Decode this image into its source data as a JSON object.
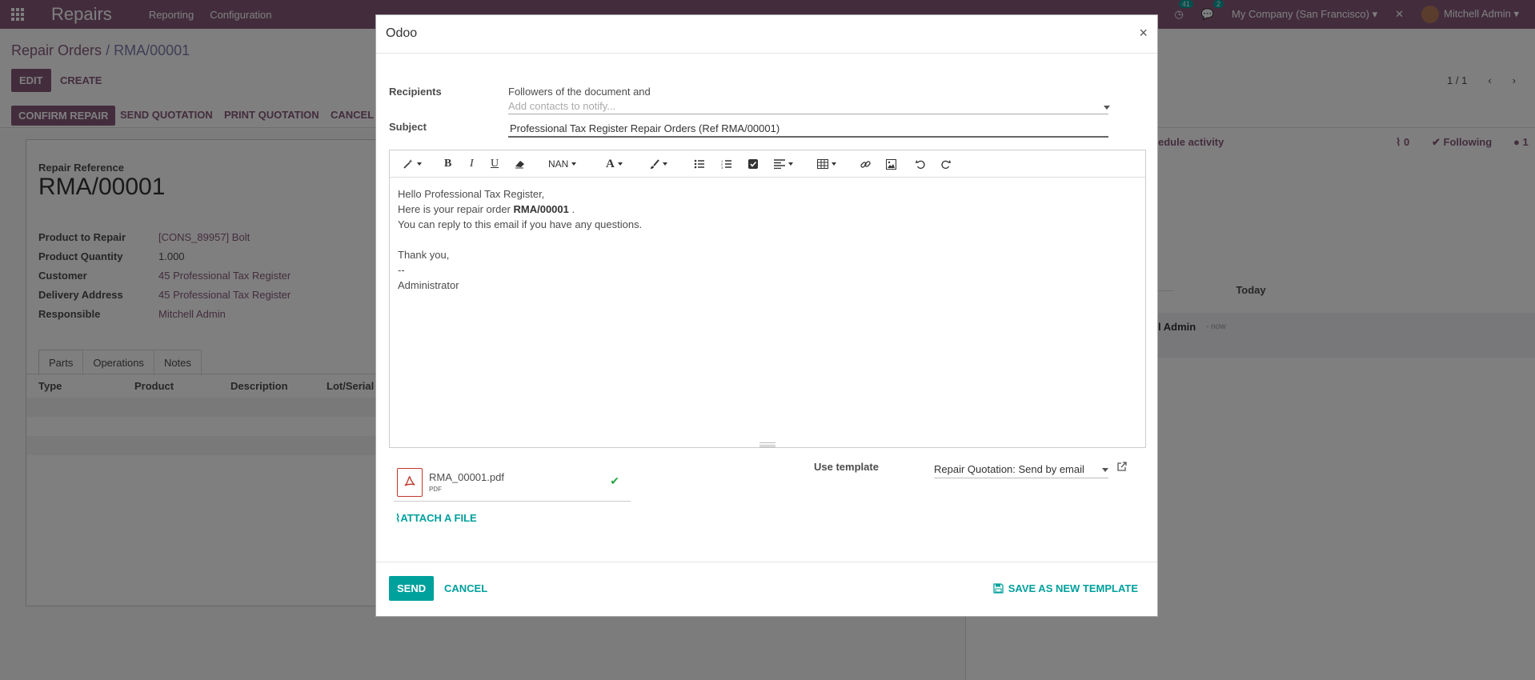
{
  "navbar": {
    "app_name": "Repairs",
    "menu": [
      "Reporting",
      "Configuration"
    ],
    "activity_count": "41",
    "message_count": "2",
    "company": "My Company (San Francisco)",
    "user": "Mitchell Admin"
  },
  "control_panel": {
    "breadcrumb_parent": "Repair Orders",
    "breadcrumb_sep": "/",
    "breadcrumb_current": "RMA/00001",
    "edit_label": "EDIT",
    "create_label": "CREATE",
    "pager": "1 / 1"
  },
  "statusbar": {
    "confirm_label": "CONFIRM REPAIR",
    "send_quotation_label": "SEND QUOTATION",
    "print_quotation_label": "PRINT QUOTATION",
    "cancel_label": "CANCEL"
  },
  "form": {
    "ref_label": "Repair Reference",
    "ref_value": "RMA/00001",
    "fields": [
      {
        "label": "Product to Repair",
        "value": "[CONS_89957] Bolt"
      },
      {
        "label": "Product Quantity",
        "value": "1.000"
      },
      {
        "label": "Customer",
        "value": "45 Professional Tax Register"
      },
      {
        "label": "Delivery Address",
        "value": "45 Professional Tax Register"
      },
      {
        "label": "Responsible",
        "value": "Mitchell Admin"
      }
    ],
    "tabs": [
      "Parts",
      "Operations",
      "Notes"
    ],
    "columns": [
      "Type",
      "Product",
      "Description",
      "Lot/Serial"
    ]
  },
  "chatter": {
    "schedule_activity": "edule activity",
    "attachments_count": "0",
    "following_label": "Following",
    "followers_count": "1",
    "today_label": "Today",
    "msg_author": "l Admin",
    "msg_time": "- now"
  },
  "modal": {
    "title": "Odoo",
    "close_symbol": "×",
    "recipients_label": "Recipients",
    "followers_text": "Followers of the document and",
    "recipients_placeholder": "Add contacts to notify...",
    "subject_label": "Subject",
    "subject_value": "Professional Tax Register Repair Orders (Ref RMA/00001)",
    "toolbar": {
      "font_size_label": "NAN"
    },
    "body": {
      "line1": "Hello Professional Tax Register,",
      "line2_prefix": "Here is your repair order ",
      "line2_bold": "RMA/00001",
      "line2_suffix": " .",
      "line3": "You can reply to this email if you have any questions.",
      "line4": "Thank you,",
      "line5": "--",
      "line6": "Administrator"
    },
    "attachment": {
      "file_name": "RMA_00001.pdf",
      "file_ext": "PDF"
    },
    "attach_file_label": "ATTACH A FILE",
    "use_template_label": "Use template",
    "template_value": "Repair Quotation: Send by email",
    "send_label": "SEND",
    "cancel_label": "CANCEL",
    "save_template_label": "SAVE AS NEW TEMPLATE"
  },
  "colors": {
    "brand": "#875a7b",
    "accent": "#00a09d",
    "success": "#28a745",
    "pdf_red": "#c0392b"
  }
}
